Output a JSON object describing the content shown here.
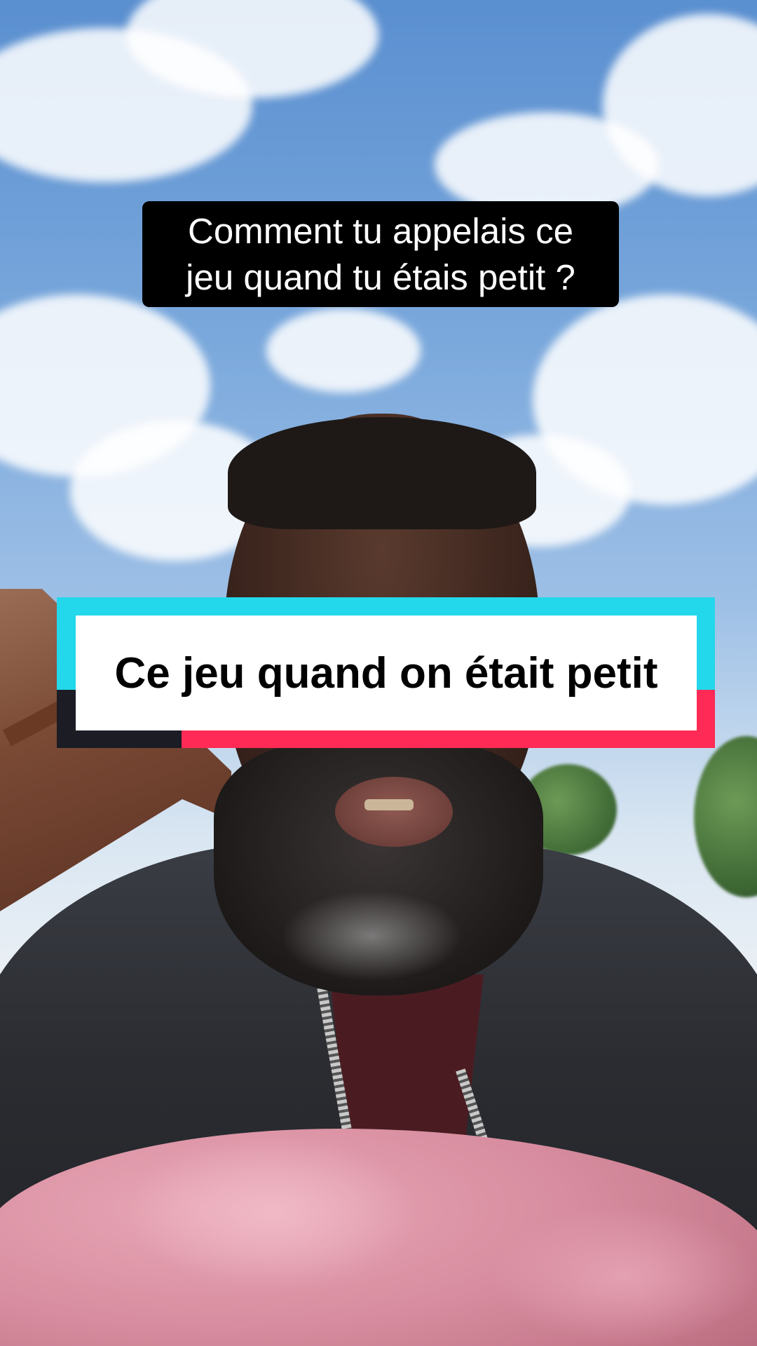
{
  "video": {
    "question_caption": "Comment tu appelais ce\njeu quand tu étais petit ?",
    "title_card": "Ce jeu quand on était petit"
  },
  "colors": {
    "caption_bg": "#000000",
    "caption_text": "#ffffff",
    "accent_cyan": "#23d8ea",
    "accent_red": "#ff2a55",
    "accent_dark": "#1b1c24",
    "title_bg": "#ffffff"
  }
}
